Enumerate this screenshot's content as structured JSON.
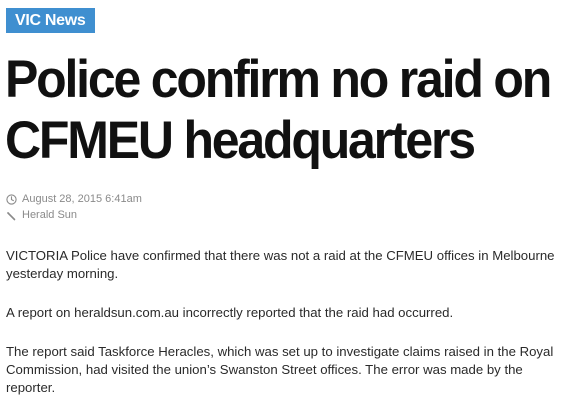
{
  "section": {
    "label": "VIC News",
    "color": "#3f8fd0"
  },
  "headline": {
    "line1": "Police confirm no raid on",
    "line2": "CFMEU headquarters"
  },
  "meta": {
    "date": "August 28, 2015 6:41am",
    "date_icon": "clock-icon",
    "source": "Herald Sun",
    "source_icon": "pen-icon"
  },
  "body": {
    "paragraphs": [
      "VICTORIA Police have confirmed that there was not a raid at the CFMEU offices in Melbourne yesterday morning.",
      "A report on heraldsun.com.au incorrectly reported that the raid had occurred.",
      "The report said Taskforce Heracles, which was set up to investigate claims raised in the Royal Commission, had visited the union’s Swanston Street offices. The error was made by the reporter."
    ]
  }
}
